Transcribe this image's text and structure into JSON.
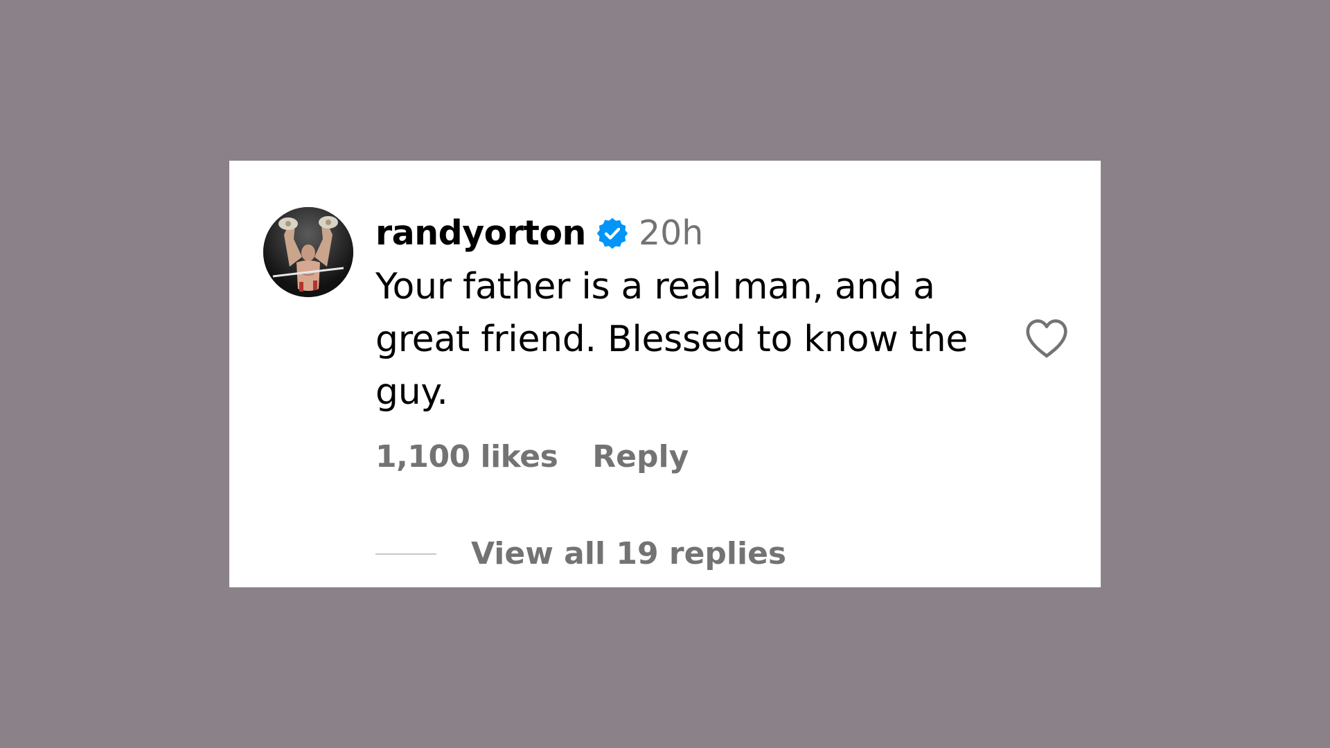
{
  "comment": {
    "username": "randyorton",
    "verified_icon": "verified-badge-icon",
    "verified_color": "#0095f6",
    "time_ago": "20h",
    "text": "Your father is a real man, and a great friend. Blessed to know the guy.",
    "like_icon": "heart-outline-icon",
    "likes_label": "1,100 likes",
    "reply_label": "Reply",
    "view_replies_label": "View all 19 replies"
  },
  "colors": {
    "background": "#8b8289",
    "card": "#ffffff",
    "text_primary": "#000000",
    "text_secondary": "#737373"
  }
}
